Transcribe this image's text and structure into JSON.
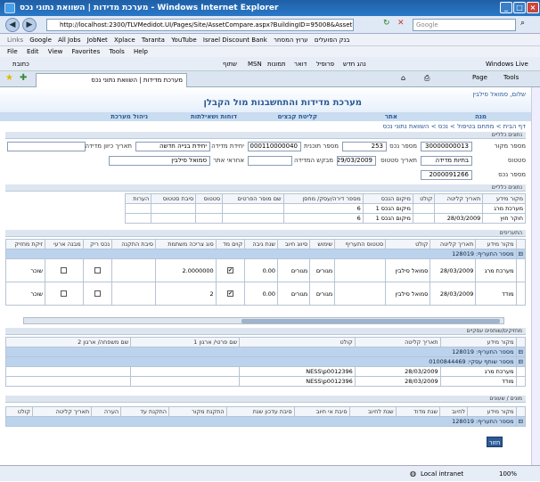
{
  "window": {
    "title": "מערכת מדידות | השוואת נתוני נכס - Windows Internet Explorer"
  },
  "browser": {
    "url": "http://localhost:2300/TLVMedidot.UI/Pages/Site/AssetCompare.aspx?BuildingID=95008&AssetID=457848",
    "search_placeholder": "Google",
    "links_label": "Links",
    "links": [
      "Google",
      "All Jobs",
      "JobNet",
      "Xplace",
      "Taranta",
      "YouTube",
      "Israel Discount Bank",
      "בנק הפועלים",
      "ערוץ המסחר"
    ],
    "menu": [
      "File",
      "Edit",
      "View",
      "Favorites",
      "Tools",
      "Help"
    ],
    "toolbar2_items": [
      "כתובת",
      "נהג חדש",
      "פרופיל",
      "דואר",
      "תמונות",
      "MSN",
      "שתוף",
      "Windows Live"
    ],
    "tab_title": "מערכת מדידות | השוואת נתוני נכס",
    "page_label": "Page",
    "tools_label": "Tools",
    "status_zone": "Local intranet",
    "zoom": "100%"
  },
  "app": {
    "title": "מערכת מדידות והתחשבנות מול הקבלן",
    "welcome": "שלום, סמואל סילבין",
    "nav": [
      "מנה",
      "אתר",
      "קליטת קבצים",
      "דוחות ושאילתות",
      "ניהול מערכת"
    ],
    "breadcrumb": "דף הבית > מתחם בטיפול > נכס > השוואת נתוני נכס"
  },
  "asset": {
    "section": "נתונים כלליים",
    "label_source_id": "מספר מקור",
    "val_source_id": "30000000013",
    "label_asset_no": "מספר נכס",
    "val_asset_no": "253",
    "label_plan_no": "מספר תוכנית",
    "val_plan_no": "000110000040",
    "label_unit": "יחידת מדידה",
    "val_unit": "יחידת בנייה חדשה",
    "label_start": "תאריך כיוון מדידה",
    "val_start": "",
    "label_status": "סטטוס",
    "val_status": "בתיות מדידה",
    "label_status_date": "תאריך סטטוס",
    "val_status_date": "29/03/2009",
    "label_measured_by": "מבקש המדידה",
    "val_measured_by": "",
    "label_responsible": "אחראי אתר",
    "val_responsible": "סמואל סילבין",
    "label_asset_id": "מספר נכס",
    "val_asset_id": "2000091266"
  },
  "general": {
    "section": "נתונים כלליים",
    "columns": [
      "מקור מידע",
      "תאריך קליטה",
      "קולט",
      "מיקום הנכס",
      "מספר דירה/עסק/ מחסן",
      "שם מוסר הפרטים",
      "סטטוס",
      "סיבת סטטוס",
      "הערות"
    ],
    "rows": [
      [
        "מערכת מרג",
        "",
        "",
        "מיקום הנכס 1",
        "6",
        "",
        "",
        "",
        ""
      ],
      [
        "חוקר חוץ",
        "28/03/2009",
        "",
        "מיקום הנכס 1",
        "6",
        "",
        "",
        "",
        ""
      ]
    ]
  },
  "rates": {
    "section": "התעריפים",
    "columns": [
      "מקור מידע",
      "תאריך קליטה",
      "קולט",
      "סטטוס התעריף",
      "שימוש",
      "סיווג חיוב",
      "שנת גיבה",
      "קוים מד",
      "סוג צריכה משתמת",
      "סיבת התקנה",
      "נכס ריק",
      "מבנה ארעי",
      "זיקת מחזיק"
    ],
    "group": "מספר התעריף: 128019",
    "rows": [
      {
        "source": "מערכת מרג",
        "date": "28/03/2009",
        "by": "סמואל סילבין",
        "status": "",
        "use": "מגורים",
        "class": "מגורים",
        "year": "0.00",
        "cb1": true,
        "type": "2.0000000",
        "reason": "",
        "empty": false,
        "temp": false,
        "holder": "שוכר"
      },
      {
        "source": "מודד",
        "date": "28/03/2009",
        "by": "סמואל סילבין",
        "status": "",
        "use": "מגורים",
        "class": "מגורים",
        "year": "0.00",
        "cb1": true,
        "type": "2",
        "reason": "",
        "empty": false,
        "temp": false,
        "holder": "שוכר"
      }
    ]
  },
  "partners": {
    "section": "מחזיקים/שותפים עסקיים",
    "columns": [
      "מקור מידע",
      "תאריך קליטה",
      "קולט",
      "שם פרטי/ ארגון 1",
      "שם משפחה/ ארגון 2"
    ],
    "group1": "מספר התעריף: 128019",
    "group2": "מספר שותף עסקי: 0100844469",
    "rows": [
      [
        "מערכת מרג",
        "28/03/2009",
        "NESS\\p0012396",
        "",
        ""
      ],
      [
        "מודד",
        "28/03/2009",
        "NESS\\p0012396",
        "",
        ""
      ]
    ]
  },
  "meters": {
    "section": "מונים / שעונים",
    "columns": [
      "מקור מידע",
      "לחיוב",
      "שנת מדוד",
      "שנת לחיוב",
      "סיבת אי חיוב",
      "סיבת עדכון שנת",
      "התקנת מקור",
      "התקנת עד",
      "הערה",
      "תאריך קליטה",
      "קולט"
    ],
    "group": "מספר התעריף: 128019"
  },
  "buttons": {
    "close": "חזור"
  }
}
